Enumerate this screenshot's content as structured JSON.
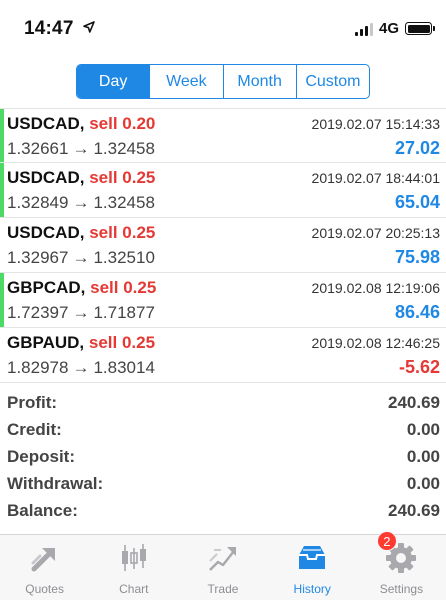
{
  "status_bar": {
    "time": "14:47",
    "network": "4G",
    "signal_bars_active": 3,
    "signal_bars_total": 4
  },
  "period_tabs": [
    {
      "label": "Day",
      "active": true
    },
    {
      "label": "Week",
      "active": false
    },
    {
      "label": "Month",
      "active": false
    },
    {
      "label": "Custom",
      "active": false
    }
  ],
  "deals": [
    {
      "symbol": "USDCAD",
      "side": "sell 0.20",
      "datetime": "2019.02.07 15:14:33",
      "open_price": "1.32661",
      "close_price": "1.32458",
      "profit": "27.02",
      "profit_color": "#1f88e5",
      "indicator": true
    },
    {
      "symbol": "USDCAD",
      "side": "sell 0.25",
      "datetime": "2019.02.07 18:44:01",
      "open_price": "1.32849",
      "close_price": "1.32458",
      "profit": "65.04",
      "profit_color": "#1f88e5",
      "indicator": true
    },
    {
      "symbol": "USDCAD",
      "side": "sell 0.25",
      "datetime": "2019.02.07 20:25:13",
      "open_price": "1.32967",
      "close_price": "1.32510",
      "profit": "75.98",
      "profit_color": "#1f88e5",
      "indicator": false
    },
    {
      "symbol": "GBPCAD",
      "side": "sell 0.25",
      "datetime": "2019.02.08 12:19:06",
      "open_price": "1.72397",
      "close_price": "1.71877",
      "profit": "86.46",
      "profit_color": "#1f88e5",
      "indicator": true
    },
    {
      "symbol": "GBPAUD",
      "side": "sell 0.25",
      "datetime": "2019.02.08 12:46:25",
      "open_price": "1.82978",
      "close_price": "1.83014",
      "profit": "-5.62",
      "profit_color": "#e53935",
      "indicator": false
    }
  ],
  "summary": [
    {
      "label": "Profit:",
      "value": "240.69"
    },
    {
      "label": "Credit:",
      "value": "0.00"
    },
    {
      "label": "Deposit:",
      "value": "0.00"
    },
    {
      "label": "Withdrawal:",
      "value": "0.00"
    },
    {
      "label": "Balance:",
      "value": "240.69"
    }
  ],
  "tabbar": [
    {
      "label": "Quotes",
      "icon": "quotes-icon",
      "active": false
    },
    {
      "label": "Chart",
      "icon": "chart-icon",
      "active": false
    },
    {
      "label": "Trade",
      "icon": "trade-icon",
      "active": false
    },
    {
      "label": "History",
      "icon": "history-icon",
      "active": true
    },
    {
      "label": "Settings",
      "icon": "settings-icon",
      "active": false,
      "badge": "2"
    }
  ],
  "colors": {
    "accent": "#1f88e5",
    "sell": "#e53935",
    "profit_positive": "#1f88e5",
    "profit_negative": "#e53935",
    "indicator": "#4cd964",
    "badge": "#ff3b30"
  }
}
